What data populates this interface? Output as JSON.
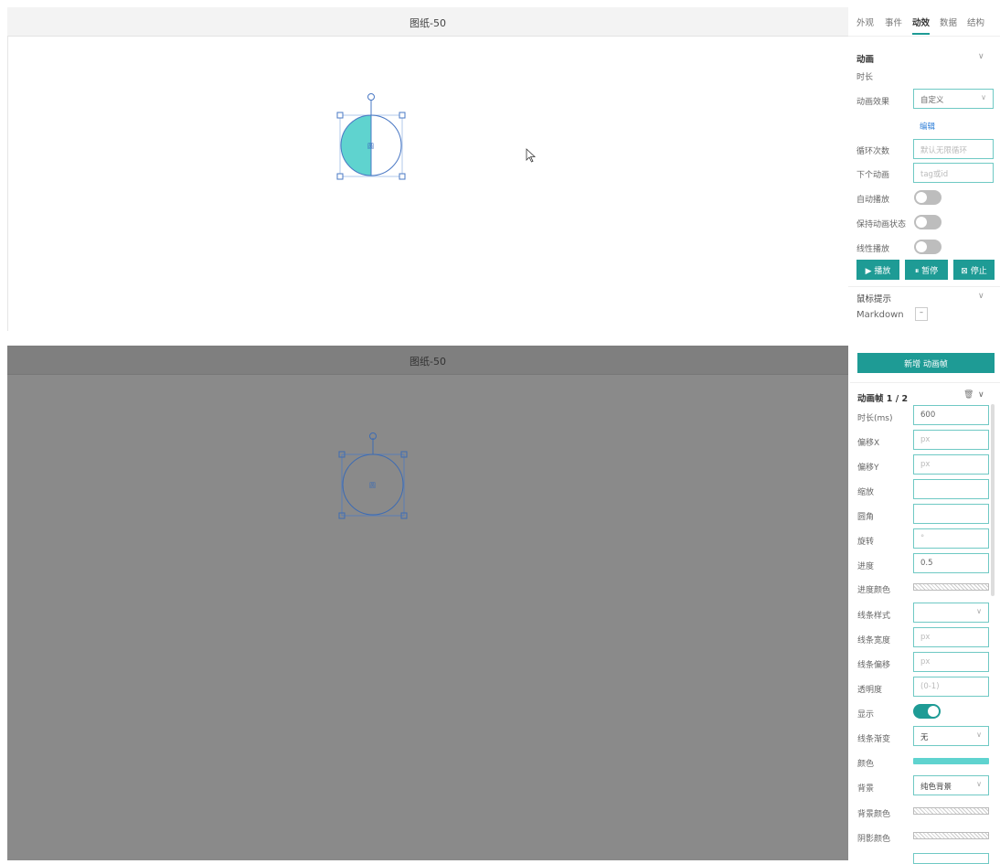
{
  "top": {
    "canvas_title": "图纸-50",
    "tabs": [
      "外观",
      "事件",
      "动效",
      "数据",
      "结构"
    ],
    "active_tab": "动效",
    "shape_label": "圆",
    "animation_section": {
      "title": "动画",
      "duration_label": "时长",
      "effect_label": "动画效果",
      "effect_value": "自定义",
      "edit_link": "编辑",
      "loop_label": "循环次数",
      "loop_placeholder": "默认无限循环",
      "next_label": "下个动画",
      "next_placeholder": "tag或id",
      "autoplay_label": "自动播放",
      "keep_state_label": "保持动画状态",
      "linear_label": "线性播放",
      "play_button": "▶ 播放",
      "pause_button": "⏸ 暂停",
      "stop_button": "⊠ 停止"
    },
    "tooltip_section": {
      "title": "鼠标提示",
      "markdown_label": "Markdown",
      "markdown_value": "–"
    }
  },
  "bottom": {
    "canvas_title": "图纸-50",
    "shape_label": "圆",
    "add_frame_button": "新增 动画帧",
    "frame_header": "动画帧 1 / 2",
    "fields": {
      "duration": {
        "label": "时长(ms)",
        "value": "600"
      },
      "offset_x": {
        "label": "偏移X",
        "placeholder": "px"
      },
      "offset_y": {
        "label": "偏移Y",
        "placeholder": "px"
      },
      "scale": {
        "label": "缩放",
        "value": ""
      },
      "radius": {
        "label": "圆角",
        "value": ""
      },
      "rotate": {
        "label": "旋转",
        "placeholder": "°"
      },
      "progress": {
        "label": "进度",
        "value": "0.5"
      },
      "progress_color": {
        "label": "进度颜色"
      },
      "line_style": {
        "label": "线条样式",
        "value": ""
      },
      "line_width": {
        "label": "线条宽度",
        "placeholder": "px"
      },
      "line_offset": {
        "label": "线条偏移",
        "placeholder": "px"
      },
      "opacity": {
        "label": "透明度",
        "placeholder": "(0-1)"
      },
      "visible": {
        "label": "显示"
      },
      "line_gradient": {
        "label": "线条渐变",
        "value": "无"
      },
      "color": {
        "label": "颜色"
      },
      "background": {
        "label": "背景",
        "value": "纯色背景"
      },
      "background_color": {
        "label": "背景颜色"
      },
      "shadow_color": {
        "label": "阴影颜色"
      }
    }
  },
  "colors": {
    "accent": "#1e9b95",
    "fill": "#5fd3cf",
    "selection": "#4a78c4",
    "overlay": "#8a8a8a"
  },
  "progress_fill": 0.5
}
